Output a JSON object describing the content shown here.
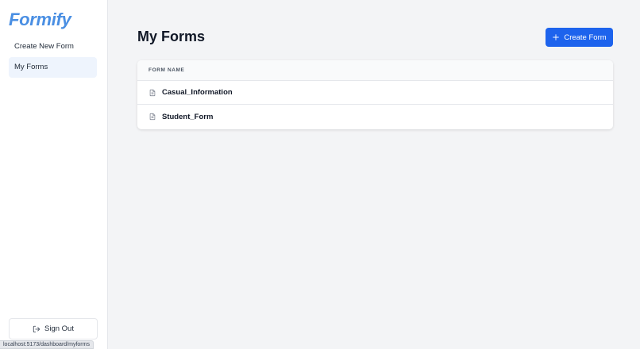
{
  "sidebar": {
    "logo": "Formify",
    "items": [
      {
        "label": "Create New Form",
        "active": false
      },
      {
        "label": "My Forms",
        "active": true
      }
    ],
    "sign_out_label": "Sign Out"
  },
  "main": {
    "title": "My Forms",
    "create_button_label": "Create Form",
    "table": {
      "column_header": "FORM NAME",
      "rows": [
        {
          "name": "Casual_Information",
          "icon": "document-icon"
        },
        {
          "name": "Student_Form",
          "icon": "document-icon"
        }
      ]
    }
  },
  "status_bar": {
    "url": "localhost:5173/dashboard/myforms"
  },
  "colors": {
    "brand": "#4a8fe3",
    "primary_button": "#1d63ed",
    "active_nav_bg": "#eef4fd",
    "page_bg": "#f3f4f6"
  }
}
